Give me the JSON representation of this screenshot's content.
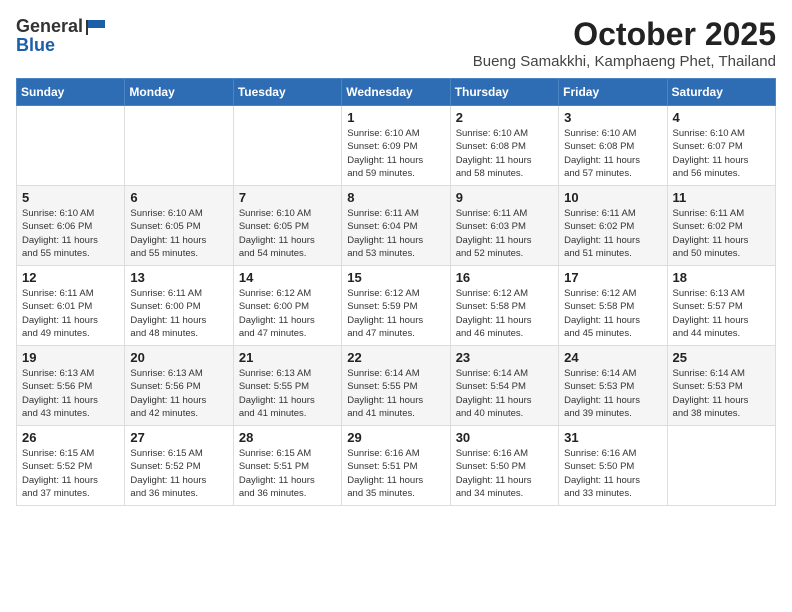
{
  "header": {
    "logo_general": "General",
    "logo_blue": "Blue",
    "month": "October 2025",
    "location": "Bueng Samakkhi, Kamphaeng Phet, Thailand"
  },
  "weekdays": [
    "Sunday",
    "Monday",
    "Tuesday",
    "Wednesday",
    "Thursday",
    "Friday",
    "Saturday"
  ],
  "weeks": [
    [
      {
        "day": "",
        "info": ""
      },
      {
        "day": "",
        "info": ""
      },
      {
        "day": "",
        "info": ""
      },
      {
        "day": "1",
        "info": "Sunrise: 6:10 AM\nSunset: 6:09 PM\nDaylight: 11 hours\nand 59 minutes."
      },
      {
        "day": "2",
        "info": "Sunrise: 6:10 AM\nSunset: 6:08 PM\nDaylight: 11 hours\nand 58 minutes."
      },
      {
        "day": "3",
        "info": "Sunrise: 6:10 AM\nSunset: 6:08 PM\nDaylight: 11 hours\nand 57 minutes."
      },
      {
        "day": "4",
        "info": "Sunrise: 6:10 AM\nSunset: 6:07 PM\nDaylight: 11 hours\nand 56 minutes."
      }
    ],
    [
      {
        "day": "5",
        "info": "Sunrise: 6:10 AM\nSunset: 6:06 PM\nDaylight: 11 hours\nand 55 minutes."
      },
      {
        "day": "6",
        "info": "Sunrise: 6:10 AM\nSunset: 6:05 PM\nDaylight: 11 hours\nand 55 minutes."
      },
      {
        "day": "7",
        "info": "Sunrise: 6:10 AM\nSunset: 6:05 PM\nDaylight: 11 hours\nand 54 minutes."
      },
      {
        "day": "8",
        "info": "Sunrise: 6:11 AM\nSunset: 6:04 PM\nDaylight: 11 hours\nand 53 minutes."
      },
      {
        "day": "9",
        "info": "Sunrise: 6:11 AM\nSunset: 6:03 PM\nDaylight: 11 hours\nand 52 minutes."
      },
      {
        "day": "10",
        "info": "Sunrise: 6:11 AM\nSunset: 6:02 PM\nDaylight: 11 hours\nand 51 minutes."
      },
      {
        "day": "11",
        "info": "Sunrise: 6:11 AM\nSunset: 6:02 PM\nDaylight: 11 hours\nand 50 minutes."
      }
    ],
    [
      {
        "day": "12",
        "info": "Sunrise: 6:11 AM\nSunset: 6:01 PM\nDaylight: 11 hours\nand 49 minutes."
      },
      {
        "day": "13",
        "info": "Sunrise: 6:11 AM\nSunset: 6:00 PM\nDaylight: 11 hours\nand 48 minutes."
      },
      {
        "day": "14",
        "info": "Sunrise: 6:12 AM\nSunset: 6:00 PM\nDaylight: 11 hours\nand 47 minutes."
      },
      {
        "day": "15",
        "info": "Sunrise: 6:12 AM\nSunset: 5:59 PM\nDaylight: 11 hours\nand 47 minutes."
      },
      {
        "day": "16",
        "info": "Sunrise: 6:12 AM\nSunset: 5:58 PM\nDaylight: 11 hours\nand 46 minutes."
      },
      {
        "day": "17",
        "info": "Sunrise: 6:12 AM\nSunset: 5:58 PM\nDaylight: 11 hours\nand 45 minutes."
      },
      {
        "day": "18",
        "info": "Sunrise: 6:13 AM\nSunset: 5:57 PM\nDaylight: 11 hours\nand 44 minutes."
      }
    ],
    [
      {
        "day": "19",
        "info": "Sunrise: 6:13 AM\nSunset: 5:56 PM\nDaylight: 11 hours\nand 43 minutes."
      },
      {
        "day": "20",
        "info": "Sunrise: 6:13 AM\nSunset: 5:56 PM\nDaylight: 11 hours\nand 42 minutes."
      },
      {
        "day": "21",
        "info": "Sunrise: 6:13 AM\nSunset: 5:55 PM\nDaylight: 11 hours\nand 41 minutes."
      },
      {
        "day": "22",
        "info": "Sunrise: 6:14 AM\nSunset: 5:55 PM\nDaylight: 11 hours\nand 41 minutes."
      },
      {
        "day": "23",
        "info": "Sunrise: 6:14 AM\nSunset: 5:54 PM\nDaylight: 11 hours\nand 40 minutes."
      },
      {
        "day": "24",
        "info": "Sunrise: 6:14 AM\nSunset: 5:53 PM\nDaylight: 11 hours\nand 39 minutes."
      },
      {
        "day": "25",
        "info": "Sunrise: 6:14 AM\nSunset: 5:53 PM\nDaylight: 11 hours\nand 38 minutes."
      }
    ],
    [
      {
        "day": "26",
        "info": "Sunrise: 6:15 AM\nSunset: 5:52 PM\nDaylight: 11 hours\nand 37 minutes."
      },
      {
        "day": "27",
        "info": "Sunrise: 6:15 AM\nSunset: 5:52 PM\nDaylight: 11 hours\nand 36 minutes."
      },
      {
        "day": "28",
        "info": "Sunrise: 6:15 AM\nSunset: 5:51 PM\nDaylight: 11 hours\nand 36 minutes."
      },
      {
        "day": "29",
        "info": "Sunrise: 6:16 AM\nSunset: 5:51 PM\nDaylight: 11 hours\nand 35 minutes."
      },
      {
        "day": "30",
        "info": "Sunrise: 6:16 AM\nSunset: 5:50 PM\nDaylight: 11 hours\nand 34 minutes."
      },
      {
        "day": "31",
        "info": "Sunrise: 6:16 AM\nSunset: 5:50 PM\nDaylight: 11 hours\nand 33 minutes."
      },
      {
        "day": "",
        "info": ""
      }
    ]
  ]
}
